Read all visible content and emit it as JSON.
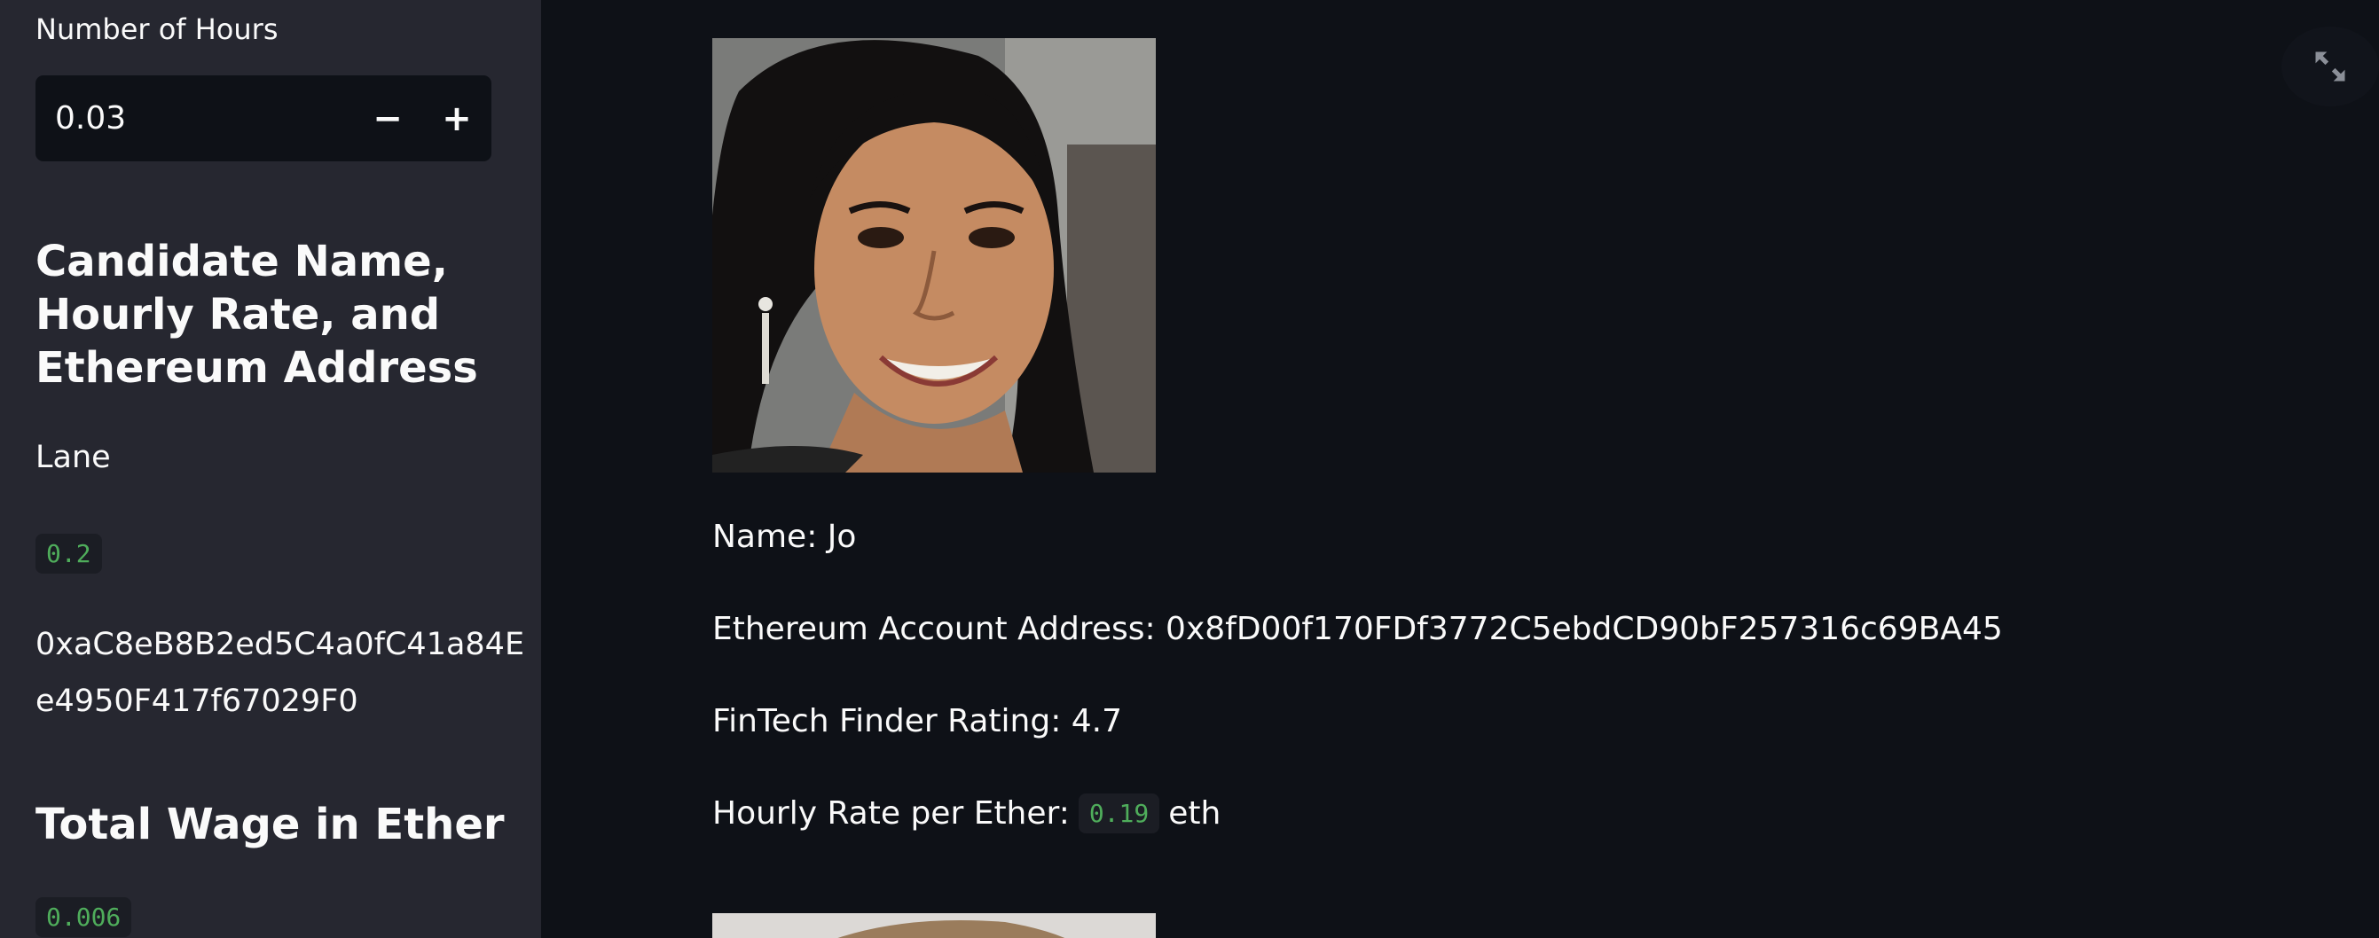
{
  "sidebar": {
    "hours_label": "Number of Hours",
    "hours_value": "0.03",
    "minus_label": "−",
    "plus_label": "+",
    "candidate_heading": "Candidate Name, Hourly Rate, and Ethereum Address",
    "candidate_name": "Lane",
    "candidate_rate": "0.2",
    "candidate_address_line1": "0xaC8eB8B2ed5C4a0fC41a84E",
    "candidate_address_line2": "e4950F417f67029F0",
    "wage_heading": "Total Wage in Ether",
    "wage_value": "0.006"
  },
  "main": {
    "card": {
      "name": "Name: Jo",
      "address": "Ethereum Account Address: 0x8fD00f170FDf3772C5ebdCD90bF257316c69BA45",
      "rating": "FinTech Finder Rating: 4.7",
      "rate_label": "Hourly Rate per Ether:",
      "rate_value": "0.19",
      "rate_unit": "eth"
    }
  },
  "colors": {
    "background": "#0e1117",
    "sidebar": "#262730",
    "code_text": "#4fad5b"
  },
  "icons": {
    "fullscreen": "expand-arrows-icon"
  }
}
